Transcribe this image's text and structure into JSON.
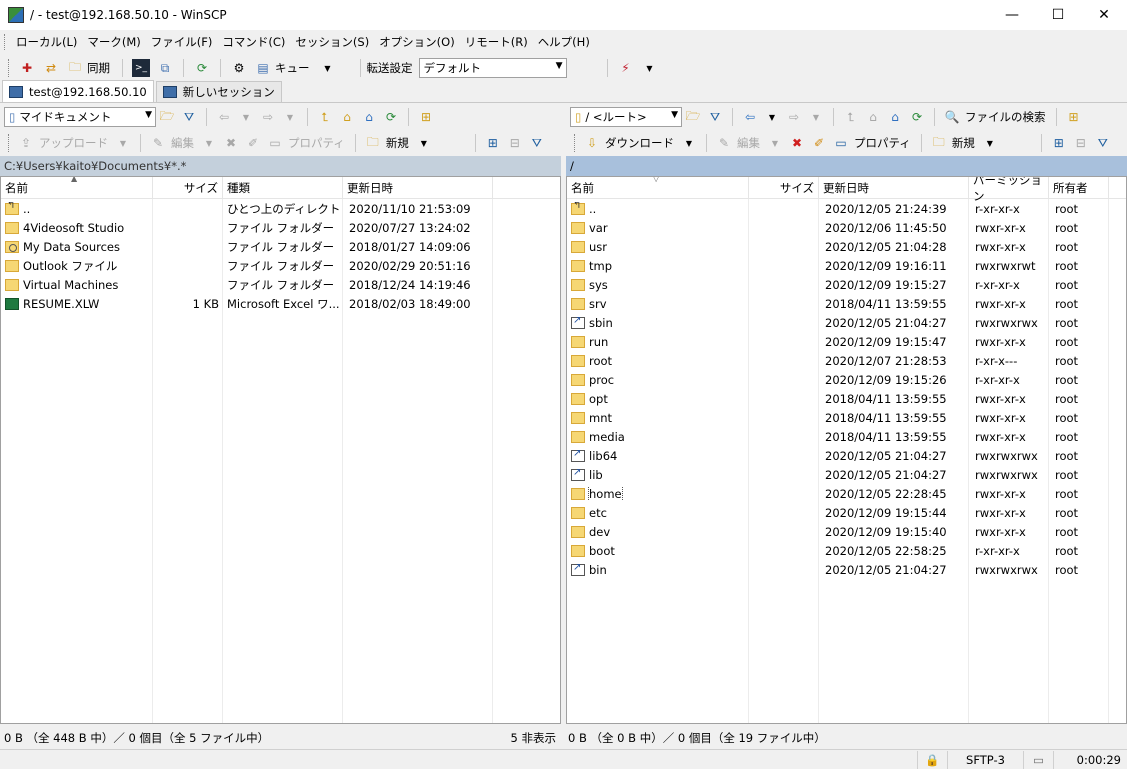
{
  "window": {
    "title": "/ - test@192.168.50.10 - WinSCP",
    "minimize": "—",
    "maximize": "☐",
    "close": "✕"
  },
  "menu": [
    "ローカル(L)",
    "マーク(M)",
    "ファイル(F)",
    "コマンド(C)",
    "セッション(S)",
    "オプション(O)",
    "リモート(R)",
    "ヘルプ(H)"
  ],
  "toolbar": {
    "sync_label": "同期",
    "queue_label": "キュー",
    "transfer_settings_label": "転送設定",
    "transfer_preset": "デフォルト"
  },
  "tabs": {
    "session_tab": "test@192.168.50.10",
    "new_session_tab": "新しいセッション"
  },
  "left": {
    "location": "マイドキュメント",
    "upload_label": "アップロード",
    "edit_label": "編集",
    "properties_label": "プロパティ",
    "new_label": "新規",
    "path": "C:¥Users¥kaito¥Documents¥*.*",
    "headers": {
      "name": "名前",
      "size": "サイズ",
      "type": "種類",
      "modified": "更新日時"
    },
    "rows": [
      {
        "name": "..",
        "size": "",
        "type": "ひとつ上のディレクトリ",
        "modified": "2020/11/10  21:53:09",
        "icon": "up"
      },
      {
        "name": "4Videosoft Studio",
        "size": "",
        "type": "ファイル フォルダー",
        "modified": "2020/07/27  13:24:02",
        "icon": "folder"
      },
      {
        "name": "My Data Sources",
        "size": "",
        "type": "ファイル フォルダー",
        "modified": "2018/01/27  14:09:06",
        "icon": "ds"
      },
      {
        "name": "Outlook ファイル",
        "size": "",
        "type": "ファイル フォルダー",
        "modified": "2020/02/29  20:51:16",
        "icon": "folder"
      },
      {
        "name": "Virtual Machines",
        "size": "",
        "type": "ファイル フォルダー",
        "modified": "2018/12/24  14:19:46",
        "icon": "folder"
      },
      {
        "name": "RESUME.XLW",
        "size": "1 KB",
        "type": "Microsoft Excel ワ...",
        "modified": "2018/02/03  18:49:00",
        "icon": "xls"
      }
    ]
  },
  "right": {
    "location": "/ <ルート>",
    "download_label": "ダウンロード",
    "edit_label": "編集",
    "properties_label": "プロパティ",
    "new_label": "新規",
    "find_label": "ファイルの検索",
    "path": "/",
    "headers": {
      "name": "名前",
      "size": "サイズ",
      "modified": "更新日時",
      "perm": "パーミッション",
      "owner": "所有者"
    },
    "rows": [
      {
        "name": "..",
        "modified": "2020/12/05 21:24:39",
        "perm": "r-xr-xr-x",
        "owner": "root",
        "icon": "up"
      },
      {
        "name": "var",
        "modified": "2020/12/06 11:45:50",
        "perm": "rwxr-xr-x",
        "owner": "root",
        "icon": "folder"
      },
      {
        "name": "usr",
        "modified": "2020/12/05 21:04:28",
        "perm": "rwxr-xr-x",
        "owner": "root",
        "icon": "folder"
      },
      {
        "name": "tmp",
        "modified": "2020/12/09 19:16:11",
        "perm": "rwxrwxrwt",
        "owner": "root",
        "icon": "folder"
      },
      {
        "name": "sys",
        "modified": "2020/12/09 19:15:27",
        "perm": "r-xr-xr-x",
        "owner": "root",
        "icon": "folder"
      },
      {
        "name": "srv",
        "modified": "2018/04/11 13:59:55",
        "perm": "rwxr-xr-x",
        "owner": "root",
        "icon": "folder"
      },
      {
        "name": "sbin",
        "modified": "2020/12/05 21:04:27",
        "perm": "rwxrwxrwx",
        "owner": "root",
        "icon": "link"
      },
      {
        "name": "run",
        "modified": "2020/12/09 19:15:47",
        "perm": "rwxr-xr-x",
        "owner": "root",
        "icon": "folder"
      },
      {
        "name": "root",
        "modified": "2020/12/07 21:28:53",
        "perm": "r-xr-x---",
        "owner": "root",
        "icon": "folder"
      },
      {
        "name": "proc",
        "modified": "2020/12/09 19:15:26",
        "perm": "r-xr-xr-x",
        "owner": "root",
        "icon": "folder"
      },
      {
        "name": "opt",
        "modified": "2018/04/11 13:59:55",
        "perm": "rwxr-xr-x",
        "owner": "root",
        "icon": "folder"
      },
      {
        "name": "mnt",
        "modified": "2018/04/11 13:59:55",
        "perm": "rwxr-xr-x",
        "owner": "root",
        "icon": "folder"
      },
      {
        "name": "media",
        "modified": "2018/04/11 13:59:55",
        "perm": "rwxr-xr-x",
        "owner": "root",
        "icon": "folder"
      },
      {
        "name": "lib64",
        "modified": "2020/12/05 21:04:27",
        "perm": "rwxrwxrwx",
        "owner": "root",
        "icon": "link"
      },
      {
        "name": "lib",
        "modified": "2020/12/05 21:04:27",
        "perm": "rwxrwxrwx",
        "owner": "root",
        "icon": "link"
      },
      {
        "name": "home",
        "modified": "2020/12/05 22:28:45",
        "perm": "rwxr-xr-x",
        "owner": "root",
        "icon": "folder"
      },
      {
        "name": "etc",
        "modified": "2020/12/09 19:15:44",
        "perm": "rwxr-xr-x",
        "owner": "root",
        "icon": "folder"
      },
      {
        "name": "dev",
        "modified": "2020/12/09 19:15:40",
        "perm": "rwxr-xr-x",
        "owner": "root",
        "icon": "folder"
      },
      {
        "name": "boot",
        "modified": "2020/12/05 22:58:25",
        "perm": "r-xr-xr-x",
        "owner": "root",
        "icon": "folder"
      },
      {
        "name": "bin",
        "modified": "2020/12/05 21:04:27",
        "perm": "rwxrwxrwx",
        "owner": "root",
        "icon": "link"
      }
    ]
  },
  "status": {
    "left": "0 B （全 448 B 中）／ 0 個目（全 5 ファイル中）",
    "hidden": "5 非表示",
    "right": "0 B （全 0 B 中）／ 0 個目（全 19 ファイル中）",
    "protocol": "SFTP-3",
    "elapsed": "0:00:29"
  }
}
